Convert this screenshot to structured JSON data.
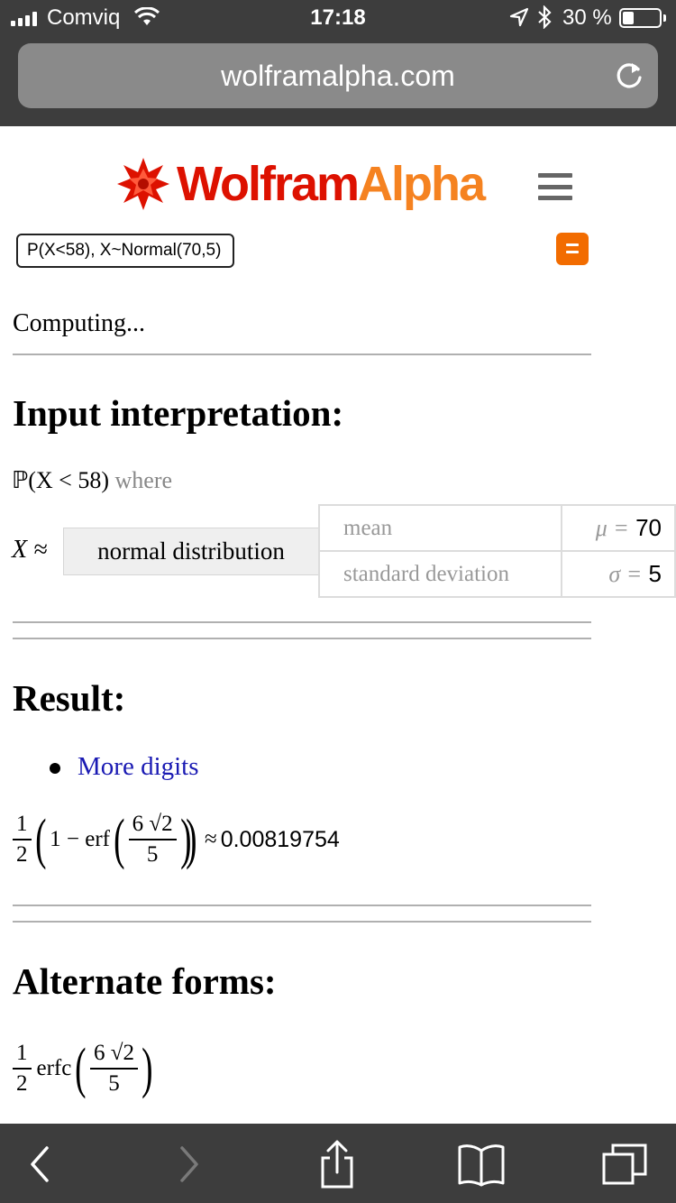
{
  "status_bar": {
    "carrier": "Comviq",
    "time": "17:18",
    "battery_percent_label": "30 %",
    "battery_level": 0.3
  },
  "browser": {
    "url": "wolframalpha.com"
  },
  "header": {
    "logo_part1": "Wolfram",
    "logo_part2": "Alpha",
    "query": "P(X<58), X~Normal(70,5)"
  },
  "status": {
    "computing": "Computing..."
  },
  "input_interpretation": {
    "heading": "Input interpretation:",
    "probability": "ℙ(X < 58)",
    "where": "where",
    "variable": "X ≈",
    "distribution": "normal distribution",
    "params": [
      {
        "label": "mean",
        "symbol": "μ =",
        "value": "70"
      },
      {
        "label": "standard deviation",
        "symbol": "σ =",
        "value": "5"
      }
    ]
  },
  "result": {
    "heading": "Result:",
    "more_digits": "More digits",
    "expression": {
      "half_num": "1",
      "half_den": "2",
      "one_minus": "1 − erf",
      "inner_num": "6 √2",
      "inner_den": "5",
      "approx_sign": "≈",
      "value": "0.00819754"
    }
  },
  "alternate_forms": {
    "heading": "Alternate forms:",
    "expression": {
      "half_num": "1",
      "half_den": "2",
      "fn": "erfc",
      "inner_num": "6 √2",
      "inner_den": "5"
    }
  },
  "colors": {
    "brand_red": "#dd1100",
    "brand_orange": "#f58220",
    "link_blue": "#1a1ab3",
    "chrome_dark": "#3d3d3d"
  }
}
